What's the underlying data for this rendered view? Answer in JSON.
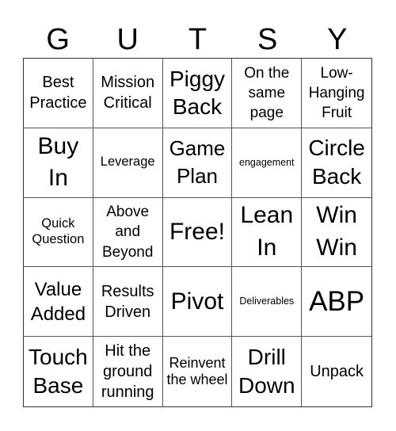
{
  "card": {
    "header_letters": [
      "G",
      "U",
      "T",
      "S",
      "Y"
    ],
    "rows": [
      [
        {
          "text": "Best Practice",
          "size": "fs-20"
        },
        {
          "text": "Mission Critical",
          "size": "fs-20"
        },
        {
          "text": "Piggy Back",
          "size": "fs-28"
        },
        {
          "text": "On the same page",
          "size": "fs-19"
        },
        {
          "text": "Low-Hanging Fruit",
          "size": "fs-19"
        }
      ],
      [
        {
          "text": "Buy In",
          "size": "fs-30"
        },
        {
          "text": "Leverage",
          "size": "fs-16"
        },
        {
          "text": "Game Plan",
          "size": "fs-26"
        },
        {
          "text": "engagement",
          "size": "fs-12"
        },
        {
          "text": "Circle Back",
          "size": "fs-28"
        }
      ],
      [
        {
          "text": "Quick Question",
          "size": "fs-16"
        },
        {
          "text": "Above and Beyond",
          "size": "fs-19"
        },
        {
          "text": "Free!",
          "size": "fs-30"
        },
        {
          "text": "Lean In",
          "size": "fs-30"
        },
        {
          "text": "Win Win",
          "size": "fs-30"
        }
      ],
      [
        {
          "text": "Value Added",
          "size": "fs-24"
        },
        {
          "text": "Results Driven",
          "size": "fs-20"
        },
        {
          "text": "Pivot",
          "size": "fs-30"
        },
        {
          "text": "Deliverables",
          "size": "fs-12"
        },
        {
          "text": "ABP",
          "size": "fs-34"
        }
      ],
      [
        {
          "text": "Touch Base",
          "size": "fs-28"
        },
        {
          "text": "Hit the ground running",
          "size": "fs-20"
        },
        {
          "text": "Reinvent the wheel",
          "size": "fs-18"
        },
        {
          "text": "Drill Down",
          "size": "fs-28"
        },
        {
          "text": "Unpack",
          "size": "fs-20"
        }
      ]
    ]
  }
}
